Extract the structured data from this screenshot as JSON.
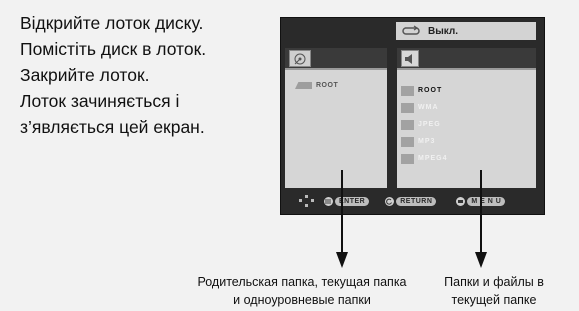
{
  "instructions": {
    "lines": [
      "Відкрийте лоток диску.",
      "Помістіть диск в лоток.",
      "Закрийте лоток.",
      "Лоток зачиняється і",
      "з’являється цей екран."
    ]
  },
  "screen": {
    "mode_value": "Выкл.",
    "mode_icon": "repeat-icon",
    "left_pane": {
      "header_icon": "disc-icon",
      "folder_label": "ROOT"
    },
    "right_pane": {
      "header_icon": "music-note-icon",
      "items": [
        "ROOT",
        "WMA",
        "JPEG",
        "MP3",
        "MPEG4"
      ]
    },
    "hints": {
      "enter": "ENTER",
      "return": "RETURN",
      "menu": "M E N U"
    }
  },
  "captions": {
    "left_line1": "Родительская папка, текущая папка",
    "left_line2": "и одноуровневые папки",
    "right_line1": "Папки и файлы в",
    "right_line2": "текущей папке"
  }
}
